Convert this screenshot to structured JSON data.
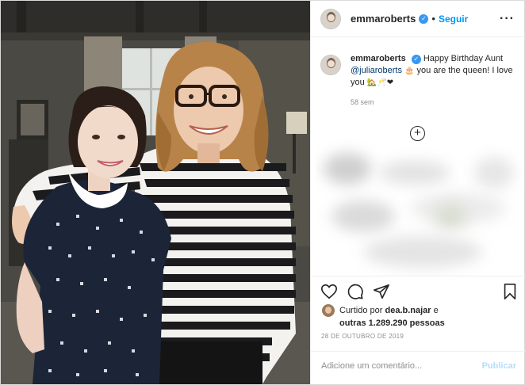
{
  "photo": {
    "alt_icon": "post-photo"
  },
  "header": {
    "username": "emmaroberts",
    "verified_icon": "verified-badge-icon",
    "separator": "•",
    "follow_label": "Seguir",
    "more_icon": "more-options-icon"
  },
  "caption": {
    "username": "emmaroberts",
    "text_before": "Happy Birthday Aunt",
    "mention": "@juliaroberts",
    "text_after": "you are the queen! I love you",
    "emoji_cake": "🎂",
    "emoji_end": "🏡🥂❤",
    "time": "58 sem"
  },
  "load_more_icon": "plus-circle-icon",
  "likes": {
    "prefix": "Curtido por",
    "user": "dea.b.najar",
    "connector": "e",
    "others": "outras 1.289.290 pessoas"
  },
  "date": "28 DE OUTUBRO DE 2019",
  "comment": {
    "placeholder": "Adicione um comentário...",
    "publish_label": "Publicar"
  },
  "colors": {
    "accent": "#0095f6",
    "publish_disabled": "#b2dffc",
    "heart": "#ed4956",
    "border": "#dbdbdb"
  }
}
